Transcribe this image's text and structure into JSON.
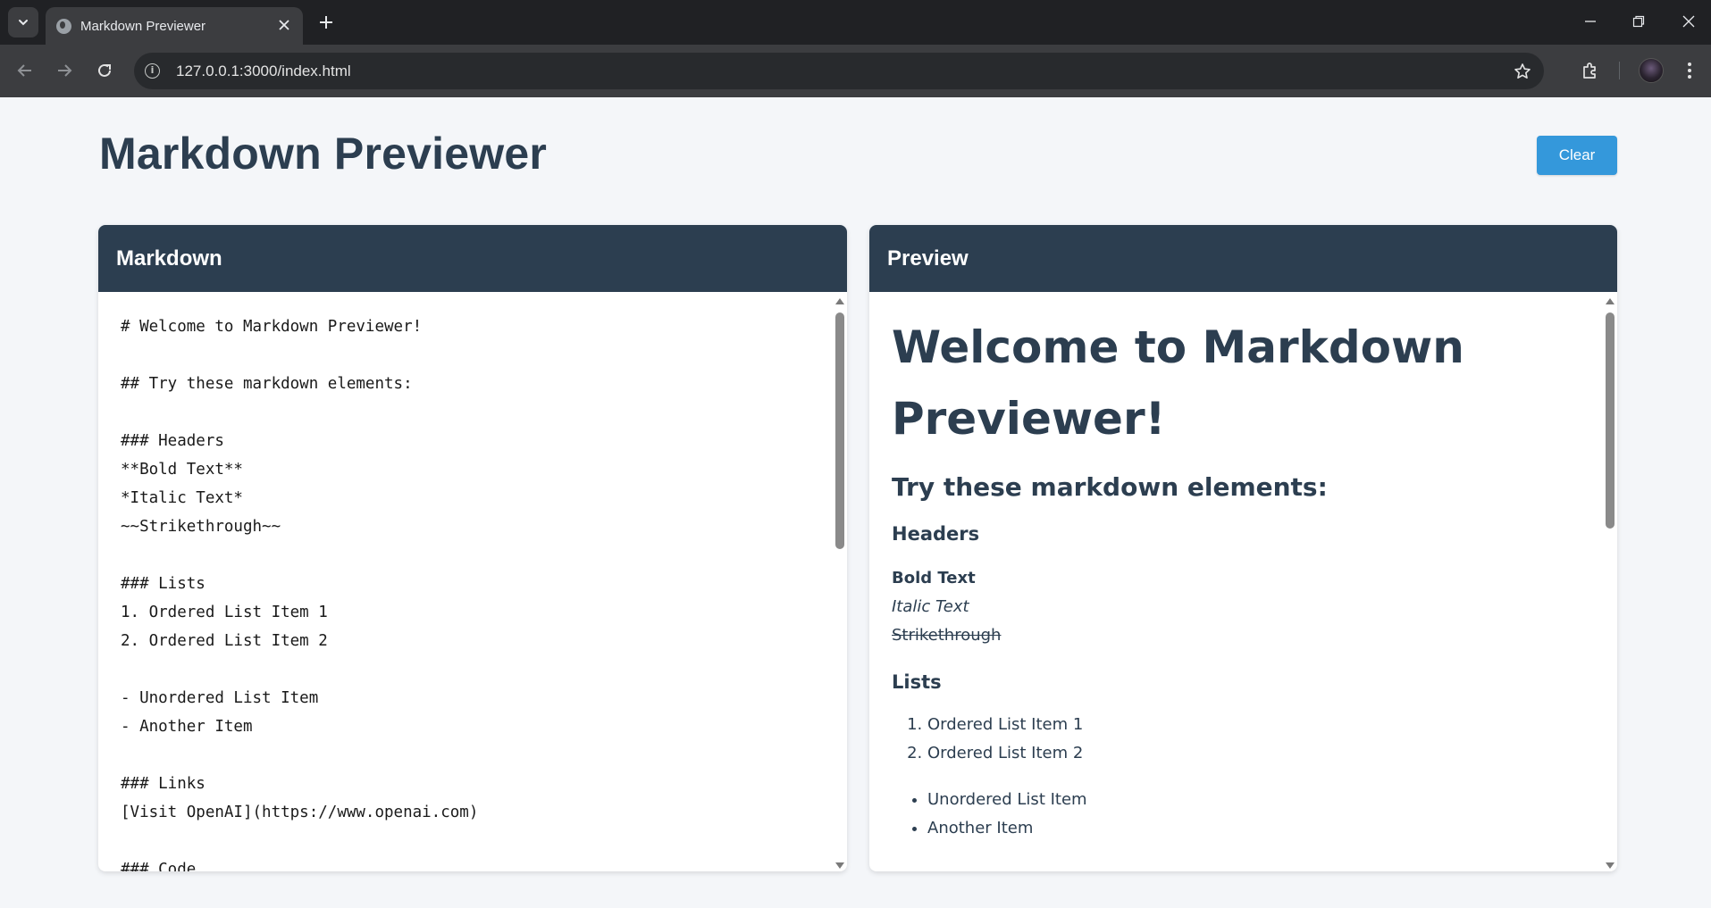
{
  "browser": {
    "tab_title": "Markdown Previewer",
    "url": "127.0.0.1:3000/index.html"
  },
  "page": {
    "title": "Markdown Previewer",
    "clear_label": "Clear",
    "accent_color": "#3498db",
    "header_color": "#2c3e50"
  },
  "editor": {
    "header": "Markdown",
    "lines": [
      "# Welcome to Markdown Previewer!",
      "",
      "## Try these markdown elements:",
      "",
      "### Headers",
      "**Bold Text**",
      "*Italic Text*",
      "~~Strikethrough~~",
      "",
      "### Lists",
      "1. Ordered List Item 1",
      "2. Ordered List Item 2",
      "",
      "- Unordered List Item",
      "- Another Item",
      "",
      "### Links",
      "[Visit OpenAI](https://www.openai.com)",
      "",
      "### Code"
    ]
  },
  "preview": {
    "header": "Preview",
    "h1": "Welcome to Markdown Previewer!",
    "h2": "Try these markdown elements:",
    "h3_headers": "Headers",
    "bold": "Bold Text",
    "italic": "Italic Text",
    "strike": "Strikethrough",
    "h3_lists": "Lists",
    "ordered": [
      "Ordered List Item 1",
      "Ordered List Item 2"
    ],
    "unordered": [
      "Unordered List Item",
      "Another Item"
    ]
  },
  "icons": {
    "tab_search": "chevron-down-icon",
    "favicon": "globe-icon",
    "close_tab": "close-icon",
    "new_tab": "plus-icon",
    "back": "arrow-left-icon",
    "forward": "arrow-right-icon",
    "reload": "reload-icon",
    "site_info": "info-icon",
    "bookmark": "star-icon",
    "extensions": "puzzle-icon",
    "menu": "kebab-icon"
  }
}
